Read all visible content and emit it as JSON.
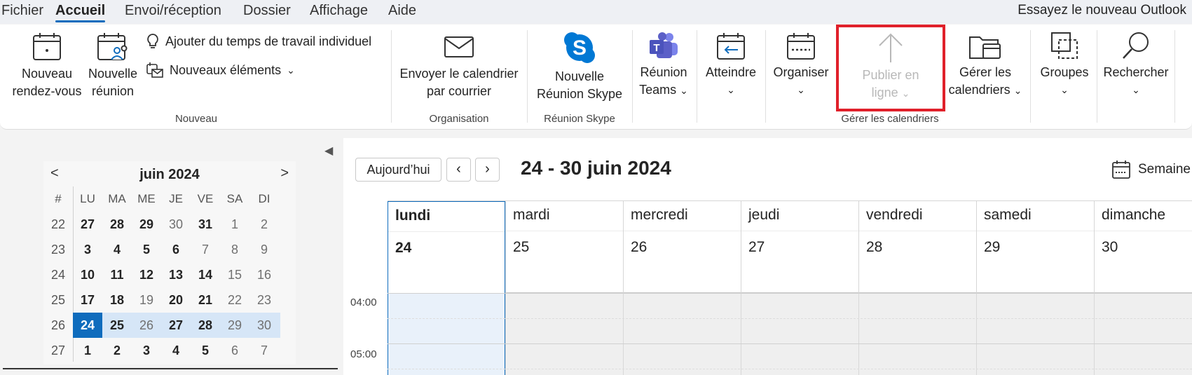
{
  "menu": {
    "items": [
      "Fichier",
      "Accueil",
      "Envoi/réception",
      "Dossier",
      "Affichage",
      "Aide"
    ],
    "active": "Accueil",
    "try_new": "Essayez le nouveau Outlook"
  },
  "ribbon": {
    "new_appointment": [
      "Nouveau",
      "rendez-vous"
    ],
    "new_meeting": [
      "Nouvelle",
      "réunion"
    ],
    "add_work_time": "Ajouter du temps de travail individuel",
    "new_items": "Nouveaux éléments",
    "group_new": "Nouveau",
    "send_calendar": [
      "Envoyer le calendrier",
      "par courrier"
    ],
    "group_organisation": "Organisation",
    "skype_meeting": [
      "Nouvelle",
      "Réunion Skype"
    ],
    "group_skype": "Réunion Skype",
    "teams_meeting": [
      "Réunion",
      "Teams"
    ],
    "goto": "Atteindre",
    "arrange": "Organiser",
    "publish_online": [
      "Publier en",
      "ligne"
    ],
    "group_manage": "Gérer les calendriers",
    "manage_calendars": [
      "Gérer les",
      "calendriers"
    ],
    "groups": "Groupes",
    "search": "Rechercher"
  },
  "minical": {
    "title": "juin 2024",
    "headers": [
      "#",
      "LU",
      "MA",
      "ME",
      "JE",
      "VE",
      "SA",
      "DI"
    ],
    "weeks": [
      {
        "num": "22",
        "days": [
          "27",
          "28",
          "29",
          "30",
          "31",
          "1",
          "2"
        ]
      },
      {
        "num": "23",
        "days": [
          "3",
          "4",
          "5",
          "6",
          "7",
          "8",
          "9"
        ]
      },
      {
        "num": "24",
        "days": [
          "10",
          "11",
          "12",
          "13",
          "14",
          "15",
          "16"
        ]
      },
      {
        "num": "25",
        "days": [
          "17",
          "18",
          "19",
          "20",
          "21",
          "22",
          "23"
        ]
      },
      {
        "num": "26",
        "days": [
          "24",
          "25",
          "26",
          "27",
          "28",
          "29",
          "30"
        ]
      },
      {
        "num": "27",
        "days": [
          "1",
          "2",
          "3",
          "4",
          "5",
          "6",
          "7"
        ]
      }
    ]
  },
  "calendar": {
    "today_label": "Aujourd’hui",
    "range": "24 - 30 juin 2024",
    "view": "Semaine",
    "days": [
      {
        "name": "lundi",
        "num": "24"
      },
      {
        "name": "mardi",
        "num": "25"
      },
      {
        "name": "mercredi",
        "num": "26"
      },
      {
        "name": "jeudi",
        "num": "27"
      },
      {
        "name": "vendredi",
        "num": "28"
      },
      {
        "name": "samedi",
        "num": "29"
      },
      {
        "name": "dimanche",
        "num": "30"
      }
    ],
    "times": [
      "04:00",
      "05:00"
    ]
  },
  "colors": {
    "accent": "#0f6cbd",
    "highlight": "#e0202a",
    "teams": "#5b5fc7",
    "skype": "#0078d4"
  }
}
